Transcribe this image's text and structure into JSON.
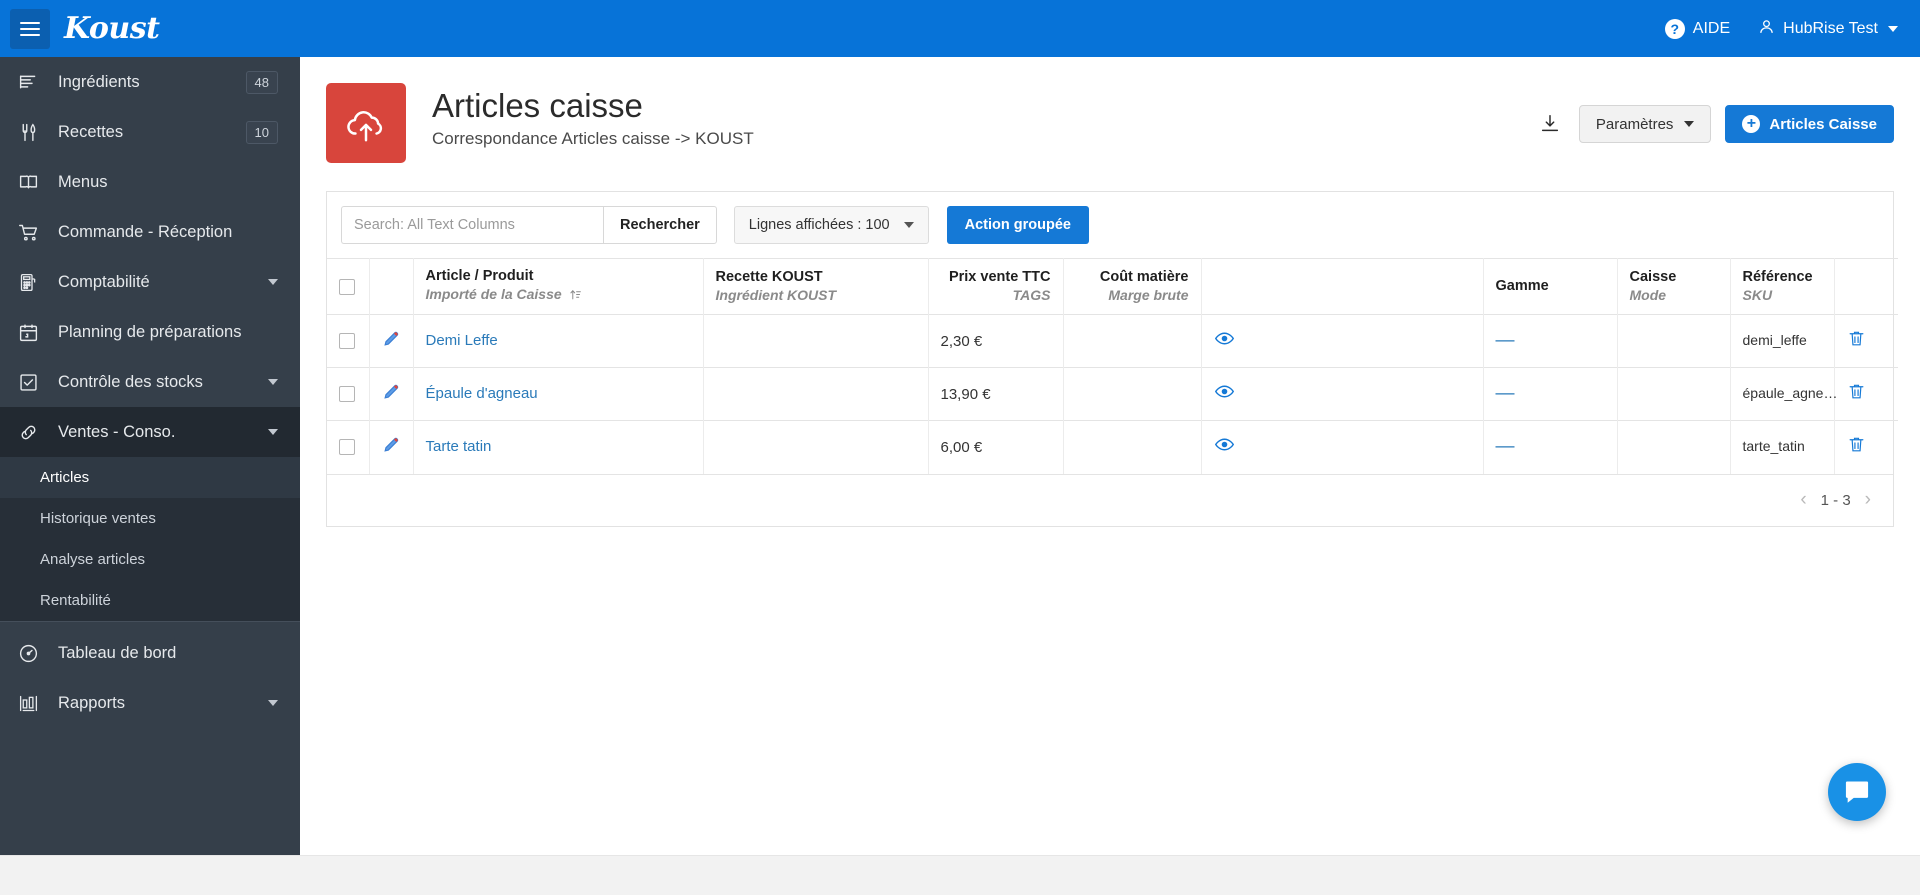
{
  "topbar": {
    "brand": "Koust",
    "menu_icon": "hamburger-icon",
    "help_label": "AIDE",
    "help_icon": "question-circle-icon",
    "user_label": "HubRise Test",
    "user_icon": "user-icon"
  },
  "sidebar": {
    "items": [
      {
        "label": "Ingrédients",
        "icon": "list-icon",
        "badge": "48",
        "chevron": false
      },
      {
        "label": "Recettes",
        "icon": "cutlery-icon",
        "badge": "10",
        "chevron": false
      },
      {
        "label": "Menus",
        "icon": "book-icon",
        "badge": "",
        "chevron": false
      },
      {
        "label": "Commande - Réception",
        "icon": "cart-icon",
        "badge": "",
        "chevron": false
      },
      {
        "label": "Comptabilité",
        "icon": "calculator-icon",
        "badge": "",
        "chevron": true
      },
      {
        "label": "Planning de préparations",
        "icon": "calendar-icon",
        "badge": "",
        "chevron": false
      },
      {
        "label": "Contrôle des stocks",
        "icon": "checkbox-icon",
        "badge": "",
        "chevron": true
      },
      {
        "label": "Ventes - Conso.",
        "icon": "link-icon",
        "badge": "",
        "chevron": true,
        "expanded": true
      }
    ],
    "subitems": [
      {
        "label": "Articles",
        "active": true
      },
      {
        "label": "Historique ventes",
        "active": false
      },
      {
        "label": "Analyse articles",
        "active": false
      },
      {
        "label": "Rentabilité",
        "active": false
      }
    ],
    "items_bottom": [
      {
        "label": "Tableau de bord",
        "icon": "gauge-icon",
        "badge": "",
        "chevron": false
      },
      {
        "label": "Rapports",
        "icon": "chart-icon",
        "badge": "",
        "chevron": true
      }
    ]
  },
  "page": {
    "icon": "cloud-upload-icon",
    "icon_color": "#d8453c",
    "title": "Articles caisse",
    "subtitle": "Correspondance Articles caisse -> KOUST",
    "download_icon": "download-icon",
    "settings_label": "Paramètres",
    "primary_label": "Articles Caisse",
    "primary_icon": "plus-circle-icon",
    "accent_color": "#1579d6"
  },
  "toolbar": {
    "search_placeholder": "Search: All Text Columns",
    "search_value": "",
    "search_button": "Rechercher",
    "rows_label": "Lignes affichées : 100",
    "group_action": "Action groupée"
  },
  "table": {
    "columns": [
      {
        "main": "",
        "sub": "",
        "type": "checkbox"
      },
      {
        "main": "",
        "sub": "",
        "type": "edit"
      },
      {
        "main": "Article / Produit",
        "sub": "Importé de la Caisse",
        "sort_icon": "sort-asc-icon",
        "align": "left"
      },
      {
        "main": "Recette KOUST",
        "sub": "Ingrédient KOUST",
        "align": "left"
      },
      {
        "main": "Prix vente TTC",
        "sub": "TAGS",
        "align": "right"
      },
      {
        "main": "Coût matière",
        "sub": "Marge brute",
        "align": "right"
      },
      {
        "main": "",
        "sub": "",
        "align": "center"
      },
      {
        "main": "Gamme",
        "sub": "",
        "align": "left"
      },
      {
        "main": "Caisse",
        "sub": "Mode",
        "align": "left"
      },
      {
        "main": "Référence",
        "sub": "SKU",
        "align": "left"
      },
      {
        "main": "",
        "sub": "",
        "type": "delete"
      }
    ],
    "rows": [
      {
        "checked": false,
        "edit_icon": "pencil-icon",
        "article": "Demi Leffe",
        "recette": "",
        "prix": "2,30 €",
        "cout": "",
        "view_icon": "eye-icon",
        "gamme": "—",
        "caisse": "",
        "reference": "demi_leffe",
        "delete_icon": "trash-icon"
      },
      {
        "checked": false,
        "edit_icon": "pencil-icon",
        "article": "Épaule d'agneau",
        "recette": "",
        "prix": "13,90 €",
        "cout": "",
        "view_icon": "eye-icon",
        "gamme": "—",
        "caisse": "",
        "reference": "épaule_agne…",
        "delete_icon": "trash-icon"
      },
      {
        "checked": false,
        "edit_icon": "pencil-icon",
        "article": "Tarte tatin",
        "recette": "",
        "prix": "6,00 €",
        "cout": "",
        "view_icon": "eye-icon",
        "gamme": "—",
        "caisse": "",
        "reference": "tarte_tatin",
        "delete_icon": "trash-icon"
      }
    ],
    "pagination": {
      "prev": "‹",
      "range": "1 - 3",
      "next": "›"
    }
  },
  "chat": {
    "icon": "chat-bubble-icon",
    "color": "#1991e6"
  }
}
